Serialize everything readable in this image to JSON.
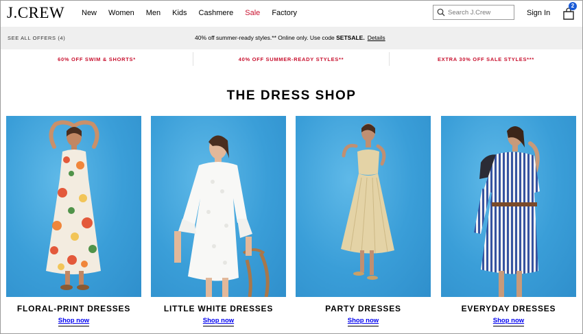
{
  "header": {
    "logo": "J.CREW",
    "nav": [
      "New",
      "Women",
      "Men",
      "Kids",
      "Cashmere",
      "Sale",
      "Factory"
    ],
    "search_placeholder": "Search J.Crew",
    "sign_in": "Sign In",
    "bag_count": "2",
    "sale_color": "#c8102e",
    "badge_color": "#1a5bd6"
  },
  "offers": {
    "see_all": "SEE ALL OFFERS (4)",
    "promo_text": "40% off summer-ready styles.** Online only. Use code ",
    "promo_code": "SETSALE.",
    "details": "Details"
  },
  "promo_strip": [
    "60% OFF SWIM & SHORTS*",
    "40% OFF SUMMER-READY STYLES**",
    "EXTRA 30% OFF SALE STYLES***"
  ],
  "main": {
    "title": "THE DRESS SHOP",
    "cards": [
      {
        "title": "FLORAL-PRINT DRESSES",
        "cta": "Shop now"
      },
      {
        "title": "LITTLE WHITE DRESSES",
        "cta": "Shop now"
      },
      {
        "title": "PARTY DRESSES",
        "cta": "Shop now"
      },
      {
        "title": "EVERYDAY DRESSES",
        "cta": "Shop now"
      }
    ],
    "backdrop_color": "#3fa4dd"
  }
}
